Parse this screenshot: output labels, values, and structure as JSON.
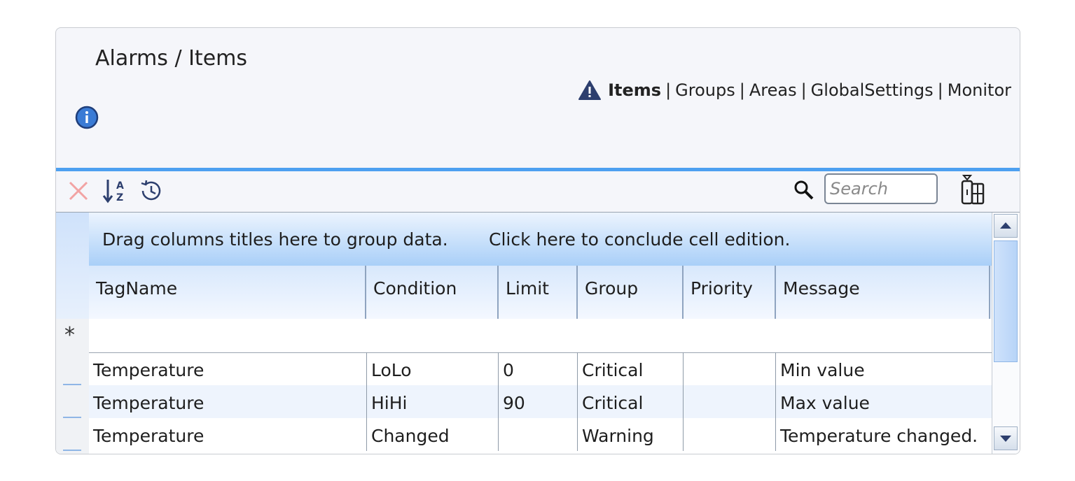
{
  "page": {
    "title": "Alarms / Items"
  },
  "nav": {
    "items": [
      {
        "label": "Items",
        "active": true
      },
      {
        "label": "Groups",
        "active": false
      },
      {
        "label": "Areas",
        "active": false
      },
      {
        "label": "GlobalSettings",
        "active": false
      },
      {
        "label": "Monitor",
        "active": false
      }
    ],
    "separator": "|",
    "icon": "warning-triangle-icon"
  },
  "info": {
    "icon": "info-icon"
  },
  "toolbar": {
    "delete_icon": "delete-x-icon",
    "sort_icon": "sort-az-icon",
    "history_icon": "history-icon",
    "search_icon": "search-icon",
    "search_placeholder": "Search",
    "column_chooser_icon": "column-chooser-icon"
  },
  "grid": {
    "group_hint": "Drag columns titles here to group data.",
    "edit_hint": "Click here to conclude cell edition.",
    "new_row_marker": "*",
    "columns": [
      "TagName",
      "Condition",
      "Limit",
      "Group",
      "Priority",
      "Message"
    ],
    "rows": [
      {
        "TagName": "Temperature",
        "Condition": "LoLo",
        "Limit": "0",
        "Group": "Critical",
        "Priority": "",
        "Message": "Min value"
      },
      {
        "TagName": "Temperature",
        "Condition": "HiHi",
        "Limit": "90",
        "Group": "Critical",
        "Priority": "",
        "Message": "Max value"
      },
      {
        "TagName": "Temperature",
        "Condition": "Changed",
        "Limit": "",
        "Group": "Warning",
        "Priority": "",
        "Message": "Temperature changed."
      }
    ]
  },
  "colors": {
    "accent": "#4da0f0",
    "header_gradient_top": "#d8e8fc",
    "warning_icon": "#2d3f6e",
    "info_icon": "#3a7bd5"
  }
}
